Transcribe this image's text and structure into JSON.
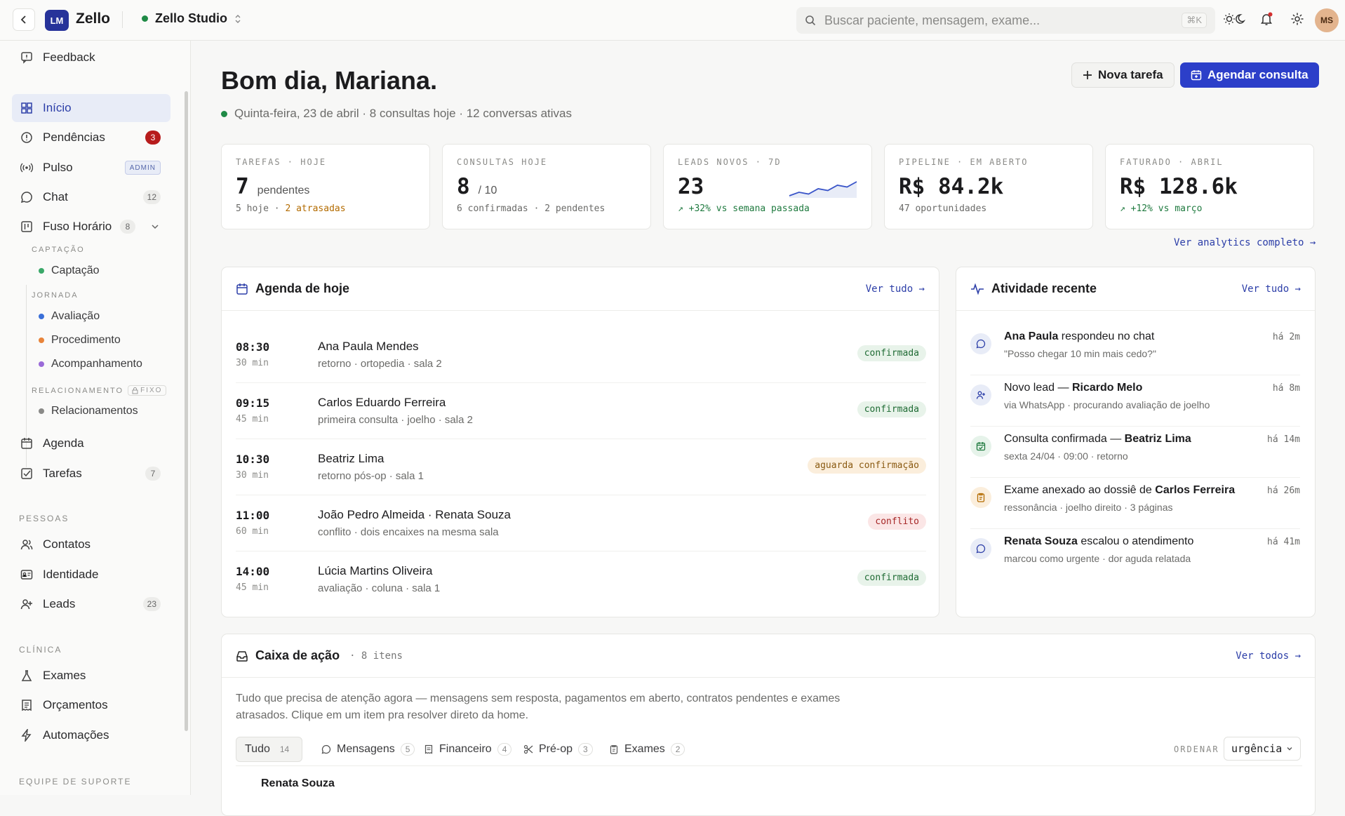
{
  "topbar": {
    "logo_initials": "LM",
    "app_name": "Zello",
    "workspace": "Zello Studio",
    "search_placeholder": "Buscar paciente, mensagem, exame...",
    "search_shortcut": "⌘K",
    "avatar_initials": "MS"
  },
  "sidebar": {
    "feedback": "Feedback",
    "items": [
      {
        "label": "Início"
      },
      {
        "label": "Pendências",
        "badge": "3"
      },
      {
        "label": "Pulso",
        "badge": "ADMIN"
      },
      {
        "label": "Chat",
        "badge": "12"
      },
      {
        "label": "Fuso Horário",
        "badge": "8"
      }
    ],
    "fuso": {
      "captacao_label": "CAPTAÇÃO",
      "captacao": "Captação",
      "jornada_label": "JORNADA",
      "avaliacao": "Avaliação",
      "procedimento": "Procedimento",
      "acompanhamento": "Acompanhamento",
      "relacionamento_label": "RELACIONAMENTO",
      "fixo": "FIXO",
      "relacionamentos": "Relacionamentos"
    },
    "agenda": "Agenda",
    "tarefas": "Tarefas",
    "tarefas_badge": "7",
    "pessoas_label": "PESSOAS",
    "contatos": "Contatos",
    "identidade": "Identidade",
    "leads": "Leads",
    "leads_badge": "23",
    "clinica_label": "CLÍNICA",
    "exames": "Exames",
    "orcamentos": "Orçamentos",
    "automacoes": "Automações",
    "suporte_label": "EQUIPE DE SUPORTE"
  },
  "header": {
    "greeting": "Bom dia, Mariana.",
    "subline": "Quinta-feira, 23 de abril · 8 consultas hoje · 12 conversas ativas",
    "new_task": "Nova tarefa",
    "schedule": "Agendar consulta"
  },
  "kpis": [
    {
      "label": "TAREFAS · HOJE",
      "value": "7",
      "unit": "pendentes",
      "foot_a": "5 hoje · ",
      "foot_b": "2 atrasadas"
    },
    {
      "label": "CONSULTAS HOJE",
      "value": "8",
      "unit": "/ 10",
      "foot_a": "6 confirmadas · 2 pendentes"
    },
    {
      "label": "LEADS NOVOS · 7D",
      "value": "23",
      "foot_a": "+32% vs semana passada"
    },
    {
      "label": "PIPELINE · EM ABERTO",
      "value": "R$ 84.2k",
      "foot_a": "47 oportunidades"
    },
    {
      "label": "FATURADO · ABRIL",
      "value": "R$ 128.6k",
      "foot_a": "+12% vs março"
    }
  ],
  "analytics_link": "Ver analytics completo →",
  "agenda": {
    "title": "Agenda de hoje",
    "link": "Ver tudo →",
    "rows": [
      {
        "time": "08:30",
        "dur": "30 min",
        "name": "Ana Paula Mendes",
        "detail": "retorno · ortopedia · sala 2",
        "status": "confirmada"
      },
      {
        "time": "09:15",
        "dur": "45 min",
        "name": "Carlos Eduardo Ferreira",
        "detail": "primeira consulta · joelho · sala 2",
        "status": "confirmada"
      },
      {
        "time": "10:30",
        "dur": "30 min",
        "name": "Beatriz Lima",
        "detail": "retorno pós-op · sala 1",
        "status": "aguarda confirmação"
      },
      {
        "time": "11:00",
        "dur": "60 min",
        "name": "João Pedro Almeida · Renata Souza",
        "detail": "conflito · dois encaixes na mesma sala",
        "status": "conflito"
      },
      {
        "time": "14:00",
        "dur": "45 min",
        "name": "Lúcia Martins Oliveira",
        "detail": "avaliação · coluna · sala 1",
        "status": "confirmada"
      }
    ]
  },
  "activity": {
    "title": "Atividade recente",
    "link": "Ver tudo →",
    "rows": [
      {
        "strong": "Ana Paula",
        "rest": " respondeu no chat",
        "sub": "\"Posso chegar 10 min mais cedo?\"",
        "time": "há 2m"
      },
      {
        "pre": "Novo lead — ",
        "strong": "Ricardo Melo",
        "sub": "via WhatsApp · procurando avaliação de joelho",
        "time": "há 8m"
      },
      {
        "pre": "Consulta confirmada — ",
        "strong": "Beatriz Lima",
        "sub": "sexta 24/04 · 09:00 · retorno",
        "time": "há 14m"
      },
      {
        "pre": "Exame anexado ao dossiê de ",
        "strong": "Carlos Ferreira",
        "sub": "ressonância · joelho direito · 3 páginas",
        "time": "há 26m"
      },
      {
        "strong": "Renata Souza",
        "rest": " escalou o atendimento",
        "sub": "marcou como urgente · dor aguda relatada",
        "time": "há 41m"
      }
    ]
  },
  "actionbox": {
    "title": "Caixa de ação",
    "count": "· 8 itens",
    "link": "Ver todos →",
    "desc": "Tudo que precisa de atenção agora — mensagens sem resposta, pagamentos em aberto, contratos pendentes e exames atrasados. Clique em um item pra resolver direto da home.",
    "tabs": [
      {
        "label": "Tudo",
        "count": "14"
      },
      {
        "label": "Mensagens",
        "count": "5"
      },
      {
        "label": "Financeiro",
        "count": "4"
      },
      {
        "label": "Pré-op",
        "count": "3"
      },
      {
        "label": "Exames",
        "count": "2"
      }
    ],
    "sort_label": "ORDENAR",
    "sort_value": "urgência",
    "first_item": "Renata Souza"
  },
  "leads_sparkline": [
    2,
    3,
    2.5,
    4,
    3.5,
    5,
    4.5,
    6
  ]
}
